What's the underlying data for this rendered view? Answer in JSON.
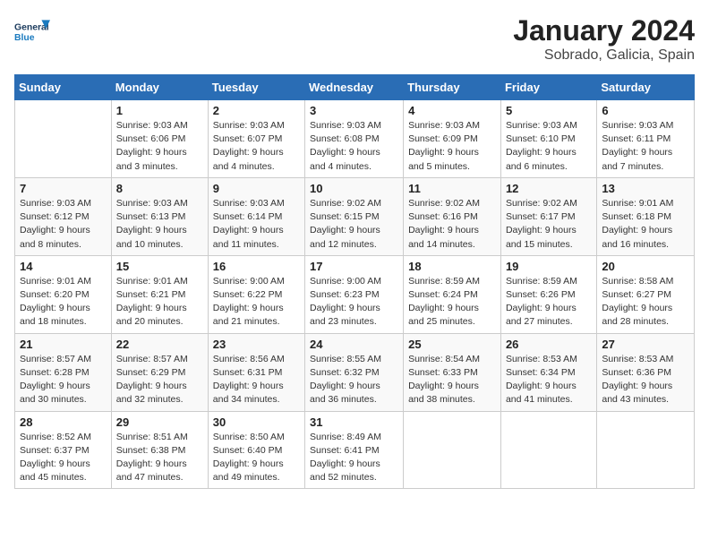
{
  "logo": {
    "text_general": "General",
    "text_blue": "Blue"
  },
  "title": "January 2024",
  "subtitle": "Sobrado, Galicia, Spain",
  "headers": [
    "Sunday",
    "Monday",
    "Tuesday",
    "Wednesday",
    "Thursday",
    "Friday",
    "Saturday"
  ],
  "weeks": [
    [
      {
        "num": "",
        "lines": []
      },
      {
        "num": "1",
        "lines": [
          "Sunrise: 9:03 AM",
          "Sunset: 6:06 PM",
          "Daylight: 9 hours",
          "and 3 minutes."
        ]
      },
      {
        "num": "2",
        "lines": [
          "Sunrise: 9:03 AM",
          "Sunset: 6:07 PM",
          "Daylight: 9 hours",
          "and 4 minutes."
        ]
      },
      {
        "num": "3",
        "lines": [
          "Sunrise: 9:03 AM",
          "Sunset: 6:08 PM",
          "Daylight: 9 hours",
          "and 4 minutes."
        ]
      },
      {
        "num": "4",
        "lines": [
          "Sunrise: 9:03 AM",
          "Sunset: 6:09 PM",
          "Daylight: 9 hours",
          "and 5 minutes."
        ]
      },
      {
        "num": "5",
        "lines": [
          "Sunrise: 9:03 AM",
          "Sunset: 6:10 PM",
          "Daylight: 9 hours",
          "and 6 minutes."
        ]
      },
      {
        "num": "6",
        "lines": [
          "Sunrise: 9:03 AM",
          "Sunset: 6:11 PM",
          "Daylight: 9 hours",
          "and 7 minutes."
        ]
      }
    ],
    [
      {
        "num": "7",
        "lines": [
          "Sunrise: 9:03 AM",
          "Sunset: 6:12 PM",
          "Daylight: 9 hours",
          "and 8 minutes."
        ]
      },
      {
        "num": "8",
        "lines": [
          "Sunrise: 9:03 AM",
          "Sunset: 6:13 PM",
          "Daylight: 9 hours",
          "and 10 minutes."
        ]
      },
      {
        "num": "9",
        "lines": [
          "Sunrise: 9:03 AM",
          "Sunset: 6:14 PM",
          "Daylight: 9 hours",
          "and 11 minutes."
        ]
      },
      {
        "num": "10",
        "lines": [
          "Sunrise: 9:02 AM",
          "Sunset: 6:15 PM",
          "Daylight: 9 hours",
          "and 12 minutes."
        ]
      },
      {
        "num": "11",
        "lines": [
          "Sunrise: 9:02 AM",
          "Sunset: 6:16 PM",
          "Daylight: 9 hours",
          "and 14 minutes."
        ]
      },
      {
        "num": "12",
        "lines": [
          "Sunrise: 9:02 AM",
          "Sunset: 6:17 PM",
          "Daylight: 9 hours",
          "and 15 minutes."
        ]
      },
      {
        "num": "13",
        "lines": [
          "Sunrise: 9:01 AM",
          "Sunset: 6:18 PM",
          "Daylight: 9 hours",
          "and 16 minutes."
        ]
      }
    ],
    [
      {
        "num": "14",
        "lines": [
          "Sunrise: 9:01 AM",
          "Sunset: 6:20 PM",
          "Daylight: 9 hours",
          "and 18 minutes."
        ]
      },
      {
        "num": "15",
        "lines": [
          "Sunrise: 9:01 AM",
          "Sunset: 6:21 PM",
          "Daylight: 9 hours",
          "and 20 minutes."
        ]
      },
      {
        "num": "16",
        "lines": [
          "Sunrise: 9:00 AM",
          "Sunset: 6:22 PM",
          "Daylight: 9 hours",
          "and 21 minutes."
        ]
      },
      {
        "num": "17",
        "lines": [
          "Sunrise: 9:00 AM",
          "Sunset: 6:23 PM",
          "Daylight: 9 hours",
          "and 23 minutes."
        ]
      },
      {
        "num": "18",
        "lines": [
          "Sunrise: 8:59 AM",
          "Sunset: 6:24 PM",
          "Daylight: 9 hours",
          "and 25 minutes."
        ]
      },
      {
        "num": "19",
        "lines": [
          "Sunrise: 8:59 AM",
          "Sunset: 6:26 PM",
          "Daylight: 9 hours",
          "and 27 minutes."
        ]
      },
      {
        "num": "20",
        "lines": [
          "Sunrise: 8:58 AM",
          "Sunset: 6:27 PM",
          "Daylight: 9 hours",
          "and 28 minutes."
        ]
      }
    ],
    [
      {
        "num": "21",
        "lines": [
          "Sunrise: 8:57 AM",
          "Sunset: 6:28 PM",
          "Daylight: 9 hours",
          "and 30 minutes."
        ]
      },
      {
        "num": "22",
        "lines": [
          "Sunrise: 8:57 AM",
          "Sunset: 6:29 PM",
          "Daylight: 9 hours",
          "and 32 minutes."
        ]
      },
      {
        "num": "23",
        "lines": [
          "Sunrise: 8:56 AM",
          "Sunset: 6:31 PM",
          "Daylight: 9 hours",
          "and 34 minutes."
        ]
      },
      {
        "num": "24",
        "lines": [
          "Sunrise: 8:55 AM",
          "Sunset: 6:32 PM",
          "Daylight: 9 hours",
          "and 36 minutes."
        ]
      },
      {
        "num": "25",
        "lines": [
          "Sunrise: 8:54 AM",
          "Sunset: 6:33 PM",
          "Daylight: 9 hours",
          "and 38 minutes."
        ]
      },
      {
        "num": "26",
        "lines": [
          "Sunrise: 8:53 AM",
          "Sunset: 6:34 PM",
          "Daylight: 9 hours",
          "and 41 minutes."
        ]
      },
      {
        "num": "27",
        "lines": [
          "Sunrise: 8:53 AM",
          "Sunset: 6:36 PM",
          "Daylight: 9 hours",
          "and 43 minutes."
        ]
      }
    ],
    [
      {
        "num": "28",
        "lines": [
          "Sunrise: 8:52 AM",
          "Sunset: 6:37 PM",
          "Daylight: 9 hours",
          "and 45 minutes."
        ]
      },
      {
        "num": "29",
        "lines": [
          "Sunrise: 8:51 AM",
          "Sunset: 6:38 PM",
          "Daylight: 9 hours",
          "and 47 minutes."
        ]
      },
      {
        "num": "30",
        "lines": [
          "Sunrise: 8:50 AM",
          "Sunset: 6:40 PM",
          "Daylight: 9 hours",
          "and 49 minutes."
        ]
      },
      {
        "num": "31",
        "lines": [
          "Sunrise: 8:49 AM",
          "Sunset: 6:41 PM",
          "Daylight: 9 hours",
          "and 52 minutes."
        ]
      },
      {
        "num": "",
        "lines": []
      },
      {
        "num": "",
        "lines": []
      },
      {
        "num": "",
        "lines": []
      }
    ]
  ]
}
